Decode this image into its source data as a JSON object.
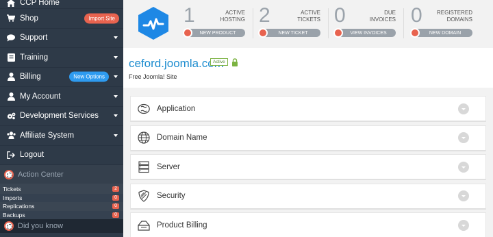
{
  "sidebar": {
    "items": [
      {
        "label": "CCP Home",
        "icon": "home-icon"
      },
      {
        "label": "Shop",
        "icon": "cart-icon",
        "badge": "Import Site"
      },
      {
        "label": "Support",
        "icon": "chat-icon"
      },
      {
        "label": "Training",
        "icon": "book-icon"
      },
      {
        "label": "Billing",
        "icon": "user-icon",
        "badge": "New Options"
      },
      {
        "label": "My Account",
        "icon": "user-icon"
      },
      {
        "label": "Development Services",
        "icon": "cogs-icon"
      },
      {
        "label": "Affiliate System",
        "icon": "users-icon"
      },
      {
        "label": "Logout",
        "icon": "logout-icon"
      }
    ],
    "action_center": {
      "title": "Action Center",
      "rows": [
        {
          "label": "Tickets",
          "count": "2"
        },
        {
          "label": "Imports",
          "count": "0"
        },
        {
          "label": "Replications",
          "count": "0"
        },
        {
          "label": "Backups",
          "count": "0"
        }
      ]
    },
    "did_you_know": "Did you know"
  },
  "stats": [
    {
      "count": "1",
      "label1": "ACTIVE",
      "label2": "HOSTING",
      "button": "NEW PRODUCT"
    },
    {
      "count": "2",
      "label1": "ACTIVE",
      "label2": "TICKETS",
      "button": "NEW TICKET"
    },
    {
      "count": "0",
      "label1": "DUE",
      "label2": "INVOICES",
      "button": "VIEW INVOICES"
    },
    {
      "count": "0",
      "label1": "REGISTERED",
      "label2": "DOMAINS",
      "button": "NEW DOMAIN"
    }
  ],
  "domain": {
    "name": "ceford.joomla.com",
    "status": "Active",
    "subtitle": "Free Joomla! Site"
  },
  "sections": [
    {
      "label": "Application",
      "icon": "joomla-icon"
    },
    {
      "label": "Domain Name",
      "icon": "globe-icon"
    },
    {
      "label": "Server",
      "icon": "server-icon"
    },
    {
      "label": "Security",
      "icon": "shield-icon"
    },
    {
      "label": "Product Billing",
      "icon": "billing-icon"
    }
  ],
  "colors": {
    "sidebar_bg": "#2e3a48",
    "accent_red": "#e8634f",
    "accent_blue": "#2e9bf0",
    "brand_blue": "#1c8ccf"
  }
}
